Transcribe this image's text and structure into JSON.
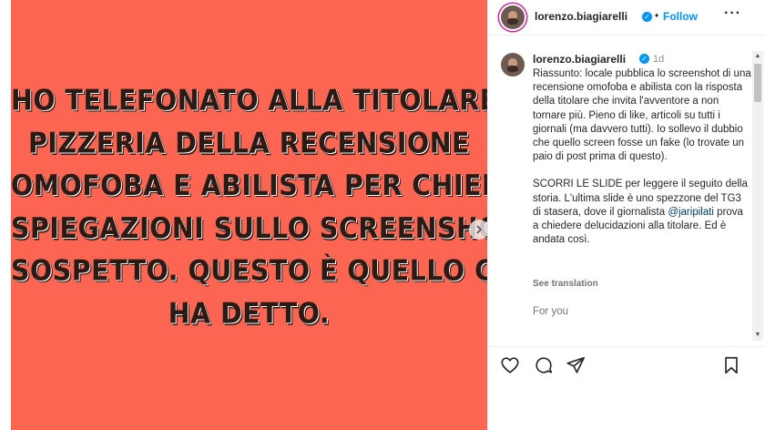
{
  "post": {
    "slide_text_lines": [
      "HO TELEFONATO ALLA TITOLARE DELLA",
      "PIZZERIA DELLA RECENSIONE",
      "OMOFOBA E ABILISTA PER CHIEDERLE",
      "SPIEGAZIONI SULLO SCREENSHOT",
      "SOSPETTO. QUESTO È QUELLO CHE MI",
      "HA DETTO."
    ],
    "slide_bg_color": "#fb6552"
  },
  "header": {
    "username": "lorenzo.biagiarelli",
    "separator": "•",
    "follow_label": "Follow",
    "more_label": "···"
  },
  "caption": {
    "username": "lorenzo.biagiarelli",
    "time": "1d",
    "paragraph1": "Riassunto: locale pubblica lo screenshot di una recensione omofoba e abilista con la risposta della titolare che invita l'avventore a non tornare più. Pieno di like, articoli su tutti i giornali (ma davvero tutti). Io sollevo il dubbio che quello screen fosse un fake (lo trovate un paio di post prima di questo).",
    "paragraph2_start": "SCORRI LE SLIDE per leggere il seguito della storia. L'ultima slide è uno spezzone del TG3 di stasera, dove il giornalista ",
    "mention": "@jaripilati",
    "paragraph2_end": " prova a chiedere delucidazioni alla titolare. Ed è andata così.",
    "see_translation": "See translation",
    "for_you": "For you"
  },
  "icons": {
    "verified": "verified-badge-icon",
    "next": "chevron-right-icon",
    "like": "heart-icon",
    "comment": "comment-icon",
    "share": "paper-plane-icon",
    "save": "bookmark-icon"
  },
  "colors": {
    "accent": "#0095f6",
    "slide_bg": "#fb6552",
    "slide_text": "#2c1a14"
  }
}
